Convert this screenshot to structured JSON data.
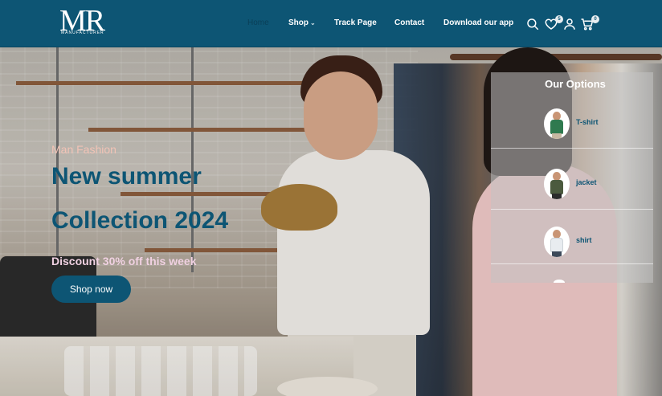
{
  "brand": {
    "logo_text": "MR",
    "logo_tagline": "MANUFACTURER"
  },
  "nav": {
    "home": "Home",
    "shop": "Shop",
    "track": "Track Page",
    "contact": "Contact",
    "download": "Download our app"
  },
  "header_icons": {
    "search": "search-icon",
    "wishlist": "heart-icon",
    "account": "user-icon",
    "cart": "cart-icon",
    "wishlist_count": "5",
    "cart_count": "0"
  },
  "hero": {
    "subtitle": "Man Fashion",
    "title_line1": "New summer",
    "title_line2": "Collection 2024",
    "discount": "Discount 30% off this week",
    "cta": "Shop now"
  },
  "options": {
    "title": "Our Options",
    "items": [
      {
        "label": "T-shirt",
        "color": "#2f7a4f"
      },
      {
        "label": "jacket",
        "color": "#4b5a3e"
      },
      {
        "label": "shirt",
        "color": "#f4f6f8"
      }
    ]
  },
  "colors": {
    "primary": "#0d5574",
    "accent_text": "#f2c3b6"
  }
}
